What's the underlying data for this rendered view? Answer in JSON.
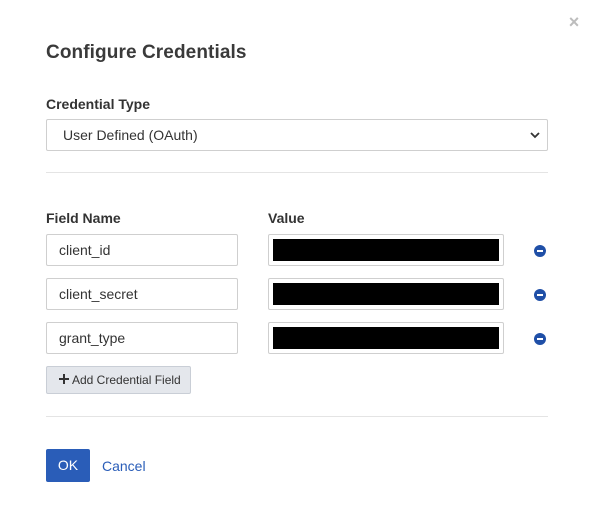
{
  "dialog": {
    "title": "Configure Credentials",
    "close_icon": "close-icon"
  },
  "credential_type": {
    "label": "Credential Type",
    "selected": "User Defined (OAuth)"
  },
  "fields": {
    "name_header": "Field Name",
    "value_header": "Value",
    "rows": [
      {
        "name": "client_id",
        "value": "[redacted]"
      },
      {
        "name": "client_secret",
        "value": "[redacted]"
      },
      {
        "name": "grant_type",
        "value": "[redacted]"
      }
    ],
    "add_button": "Add Credential Field"
  },
  "actions": {
    "ok": "OK",
    "cancel": "Cancel"
  },
  "colors": {
    "accent": "#2a5db8",
    "remove_icon": "#1f4fa7"
  }
}
